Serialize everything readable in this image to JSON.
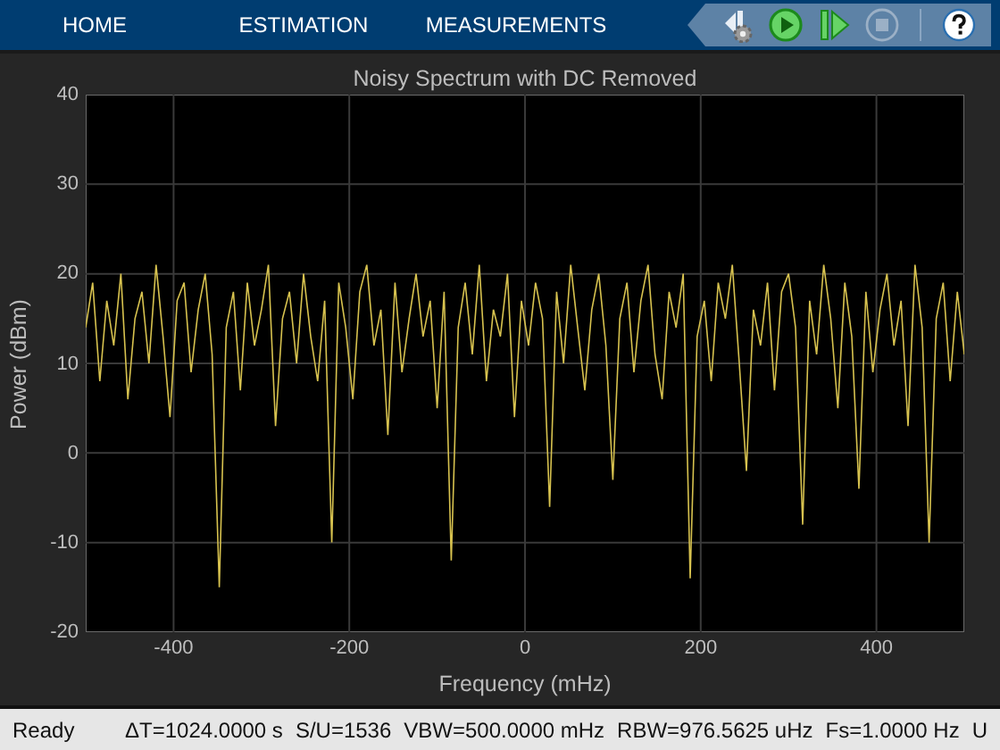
{
  "tabs": [
    {
      "label": "HOME",
      "selected": false
    },
    {
      "label": "ESTIMATION",
      "selected": false
    },
    {
      "label": "MEASUREMENTS",
      "selected": false
    }
  ],
  "toolbar": [
    {
      "kind": "settings",
      "disabled": false
    },
    {
      "kind": "run",
      "disabled": false
    },
    {
      "kind": "step",
      "disabled": false
    },
    {
      "kind": "stop",
      "disabled": true
    },
    {
      "kind": "help",
      "disabled": false
    }
  ],
  "plot": {
    "chart_data": {
      "type": "line",
      "title": "Noisy Spectrum with DC Removed",
      "xlabel": "Frequency (mHz)",
      "ylabel": "Power (dBm)",
      "xlim": [
        -500,
        500
      ],
      "ylim": [
        -20,
        40
      ],
      "xticks": [
        -400,
        -200,
        0,
        200,
        400
      ],
      "yticks": [
        -20,
        -10,
        0,
        10,
        20,
        30,
        40
      ],
      "grid": true,
      "x": [
        -500,
        -492,
        -484,
        -476,
        -468,
        -460,
        -452,
        -444,
        -436,
        -428,
        -420,
        -412,
        -404,
        -396,
        -388,
        -380,
        -372,
        -364,
        -356,
        -348,
        -340,
        -332,
        -324,
        -316,
        -308,
        -300,
        -292,
        -284,
        -276,
        -268,
        -260,
        -252,
        -244,
        -236,
        -228,
        -220,
        -212,
        -204,
        -196,
        -188,
        -180,
        -172,
        -164,
        -156,
        -148,
        -140,
        -132,
        -124,
        -116,
        -108,
        -100,
        -92,
        -84,
        -76,
        -68,
        -60,
        -52,
        -44,
        -36,
        -28,
        -20,
        -12,
        -4,
        4,
        12,
        20,
        28,
        36,
        44,
        52,
        60,
        68,
        76,
        84,
        92,
        100,
        108,
        116,
        124,
        132,
        140,
        148,
        156,
        164,
        172,
        180,
        188,
        196,
        204,
        212,
        220,
        228,
        236,
        244,
        252,
        260,
        268,
        276,
        284,
        292,
        300,
        308,
        316,
        324,
        332,
        340,
        348,
        356,
        364,
        372,
        380,
        388,
        396,
        404,
        412,
        420,
        428,
        436,
        444,
        452,
        460,
        468,
        476,
        484,
        492,
        500
      ],
      "series": [
        {
          "color": "#d7c24f",
          "values": [
            14,
            19,
            8,
            17,
            12,
            20,
            6,
            15,
            18,
            10,
            21,
            13,
            4,
            17,
            19,
            9,
            16,
            20,
            11,
            -15,
            14,
            18,
            7,
            19,
            12,
            16,
            21,
            3,
            15,
            18,
            10,
            20,
            13,
            8,
            17,
            -10,
            19,
            14,
            6,
            18,
            21,
            12,
            16,
            2,
            19,
            9,
            15,
            20,
            13,
            17,
            5,
            18,
            -12,
            14,
            19,
            11,
            21,
            8,
            16,
            13,
            20,
            4,
            17,
            12,
            19,
            15,
            -6,
            18,
            10,
            21,
            14,
            7,
            16,
            20,
            12,
            -3,
            15,
            19,
            9,
            17,
            21,
            11,
            6,
            18,
            14,
            20,
            -14,
            13,
            17,
            8,
            19,
            15,
            21,
            10,
            -2,
            16,
            12,
            19,
            7,
            18,
            20,
            14,
            -8,
            17,
            11,
            21,
            15,
            5,
            19,
            13,
            -4,
            18,
            9,
            16,
            20,
            12,
            17,
            3,
            21,
            14,
            -10,
            15,
            19,
            8,
            18,
            11
          ]
        }
      ]
    }
  },
  "status_bar": {
    "state": "Ready",
    "items": [
      "ΔT=1024.0000 s",
      "S/U=1536",
      "VBW=500.0000 mHz",
      "RBW=976.5625 uHz",
      "Fs=1.0000 Hz",
      "U"
    ]
  }
}
